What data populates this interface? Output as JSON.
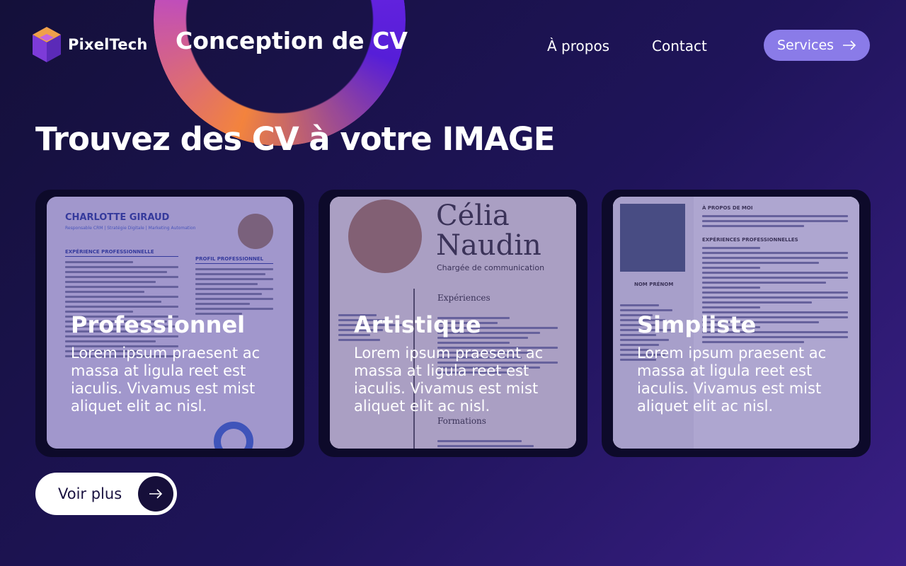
{
  "brand": {
    "name": "PixelTech",
    "logo_icon": "cube-logo-icon"
  },
  "header": {
    "title": "Conception de CV"
  },
  "nav": {
    "about_label": "À propos",
    "contact_label": "Contact",
    "services_label": "Services",
    "services_icon": "arrow-right-icon"
  },
  "hero": {
    "heading": "Trouvez des CV à votre IMAGE"
  },
  "cards": [
    {
      "title": "Professionnel",
      "description": "Lorem ipsum praesent ac massa at ligula reet est iaculis. Vivamus est mist aliquet elit ac nisl.",
      "preview": {
        "name": "CHARLOTTE GIRAUD",
        "role": "Responsable CRM | Stratégie Digitale | Marketing Automation",
        "section_left": "EXPÉRIENCE PROFESSIONNELLE",
        "section_right": "PROFIL PROFESSIONNEL"
      }
    },
    {
      "title": "Artistique",
      "description": "Lorem ipsum praesent ac massa at ligula reet est iaculis. Vivamus est mist aliquet elit ac nisl.",
      "preview": {
        "name": "Célia Naudin",
        "role": "Chargée de communication",
        "section_1": "Expériences",
        "section_2": "Formations"
      }
    },
    {
      "title": "Simpliste",
      "description": "Lorem ipsum praesent ac massa at ligula reet est iaculis. Vivamus est mist aliquet elit ac nisl.",
      "preview": {
        "name": "NOM PRÉNOM",
        "section_1": "À PROPOS DE MOI",
        "section_2": "EXPÉRIENCES PROFESSIONNELLES"
      }
    }
  ],
  "cta": {
    "label": "Voir plus",
    "icon": "arrow-right-icon"
  },
  "colors": {
    "accent": "#8a7be8",
    "background": "#1f145a",
    "card": "#0d0a2a"
  }
}
